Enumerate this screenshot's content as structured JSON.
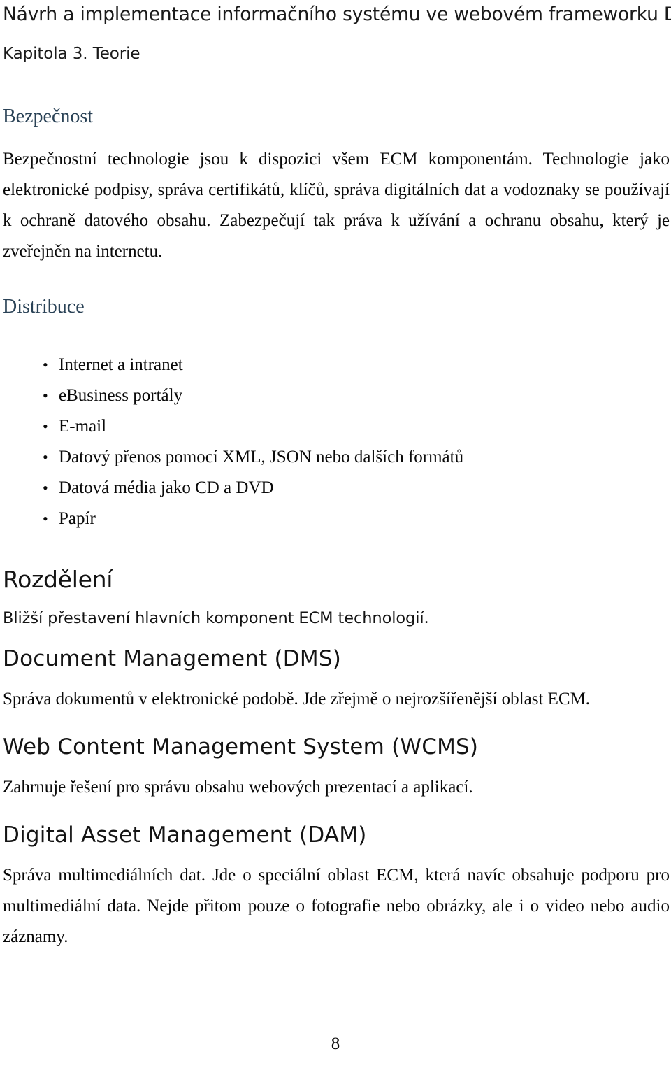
{
  "header": {
    "document_title": "Návrh a implementace informačního systému ve webovém frameworku Django",
    "chapter": "Kapitola 3. Teorie"
  },
  "sections": {
    "security": {
      "heading": "Bezpečnost",
      "paragraph": "Bezpečnostní technologie jsou k dispozici všem ECM komponentám. Technologie jako elektronické podpisy, správa certifikátů, klíčů, správa digitálních dat a vodoznaky se používají k ochraně datového obsahu. Zabezpečují tak práva k užívání a ochranu obsahu, který je zveřejněn na internetu."
    },
    "distribution": {
      "heading": "Distribuce",
      "bullets": [
        "Internet a intranet",
        "eBusiness portály",
        "E-mail",
        "Datový přenos pomocí XML, JSON nebo dalších formátů",
        "Datová média jako CD a DVD",
        "Papír"
      ],
      "bullet_glyph": "•"
    },
    "division": {
      "heading": "Rozdělení",
      "lead": "Bližší přestavení hlavních komponent ECM technologií."
    },
    "dms": {
      "heading": "Document Management (DMS)",
      "paragraph": "Správa dokumentů v elektronické podobě. Jde zřejmě o nejrozšířenější oblast ECM."
    },
    "wcms": {
      "heading": "Web Content Management System (WCMS)",
      "paragraph": "Zahrnuje řešení pro správu obsahu webových prezentací a aplikací."
    },
    "dam": {
      "heading": "Digital Asset Management (DAM)",
      "paragraph": "Správa multimediálních dat. Jde o speciální oblast ECM, která navíc obsahuje podporu pro multimediální data. Nejde přitom pouze o fotografie nebo obrázky, ale i o video nebo audio záznamy."
    }
  },
  "footer": {
    "page_number": "8"
  },
  "colors": {
    "heading_accent": "#2a4256",
    "body_text": "#0a0a0a",
    "page_background": "#ffffff"
  }
}
